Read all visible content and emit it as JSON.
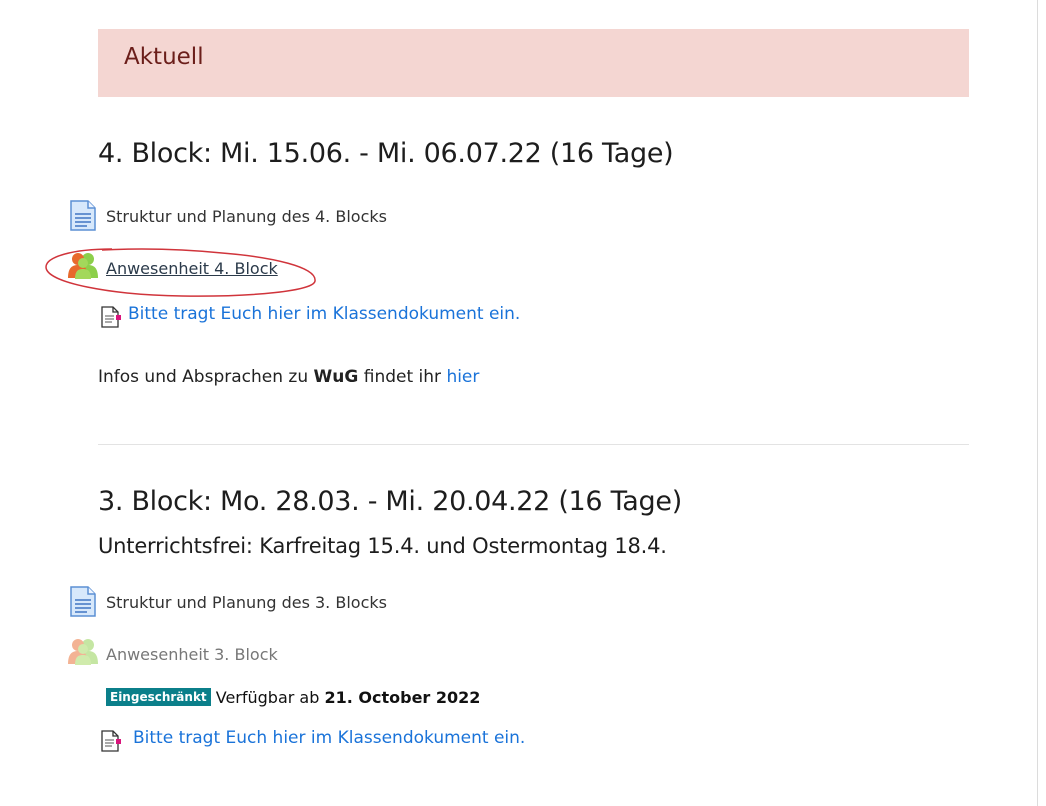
{
  "banner": {
    "title": "Aktuell"
  },
  "block4": {
    "heading": "4. Block: Mi. 15.06. - Mi. 06.07.22  (16 Tage)",
    "items": [
      {
        "label": "Struktur und Planung des 4. Blocks",
        "icon": "page-icon"
      },
      {
        "label": "Anwesenheit 4. Block",
        "icon": "attendance-icon"
      }
    ],
    "doc_link": "Bitte tragt Euch hier im Klassendokument ein.",
    "info_prefix": "Infos und Absprachen zu ",
    "info_bold": "WuG",
    "info_suffix": " findet ihr ",
    "info_link": "hier"
  },
  "block3": {
    "heading": "3. Block: Mo. 28.03. - Mi. 20.04.22  (16 Tage)",
    "subheading": "Unterrichtsfrei: Karfreitag 15.4.  und Ostermontag 18.4.",
    "items": [
      {
        "label": "Struktur und Planung des 3. Blocks",
        "icon": "page-icon"
      },
      {
        "label": "Anwesenheit 3. Block",
        "icon": "attendance-icon"
      }
    ],
    "restriction": {
      "badge": "Eingeschränkt",
      "prefix": "Verfügbar ab ",
      "date": "21. October 2022"
    },
    "doc_link": "Bitte tragt Euch hier im Klassendokument ein."
  },
  "colors": {
    "banner_bg": "#f4d6d2",
    "link": "#1a73d9",
    "badge_bg": "#0b7f8a",
    "annotation": "#d0343b"
  }
}
